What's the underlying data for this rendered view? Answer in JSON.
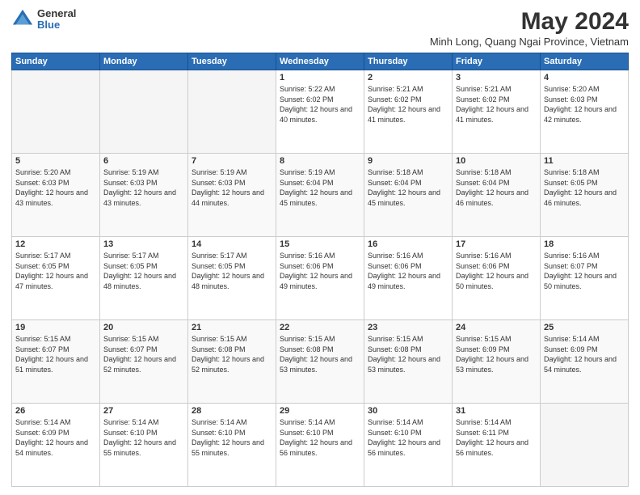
{
  "logo": {
    "general": "General",
    "blue": "Blue"
  },
  "title": "May 2024",
  "subtitle": "Minh Long, Quang Ngai Province, Vietnam",
  "days_header": [
    "Sunday",
    "Monday",
    "Tuesday",
    "Wednesday",
    "Thursday",
    "Friday",
    "Saturday"
  ],
  "weeks": [
    [
      {
        "day": "",
        "info": ""
      },
      {
        "day": "",
        "info": ""
      },
      {
        "day": "",
        "info": ""
      },
      {
        "day": "1",
        "info": "Sunrise: 5:22 AM\nSunset: 6:02 PM\nDaylight: 12 hours\nand 40 minutes."
      },
      {
        "day": "2",
        "info": "Sunrise: 5:21 AM\nSunset: 6:02 PM\nDaylight: 12 hours\nand 41 minutes."
      },
      {
        "day": "3",
        "info": "Sunrise: 5:21 AM\nSunset: 6:02 PM\nDaylight: 12 hours\nand 41 minutes."
      },
      {
        "day": "4",
        "info": "Sunrise: 5:20 AM\nSunset: 6:03 PM\nDaylight: 12 hours\nand 42 minutes."
      }
    ],
    [
      {
        "day": "5",
        "info": "Sunrise: 5:20 AM\nSunset: 6:03 PM\nDaylight: 12 hours\nand 43 minutes."
      },
      {
        "day": "6",
        "info": "Sunrise: 5:19 AM\nSunset: 6:03 PM\nDaylight: 12 hours\nand 43 minutes."
      },
      {
        "day": "7",
        "info": "Sunrise: 5:19 AM\nSunset: 6:03 PM\nDaylight: 12 hours\nand 44 minutes."
      },
      {
        "day": "8",
        "info": "Sunrise: 5:19 AM\nSunset: 6:04 PM\nDaylight: 12 hours\nand 45 minutes."
      },
      {
        "day": "9",
        "info": "Sunrise: 5:18 AM\nSunset: 6:04 PM\nDaylight: 12 hours\nand 45 minutes."
      },
      {
        "day": "10",
        "info": "Sunrise: 5:18 AM\nSunset: 6:04 PM\nDaylight: 12 hours\nand 46 minutes."
      },
      {
        "day": "11",
        "info": "Sunrise: 5:18 AM\nSunset: 6:05 PM\nDaylight: 12 hours\nand 46 minutes."
      }
    ],
    [
      {
        "day": "12",
        "info": "Sunrise: 5:17 AM\nSunset: 6:05 PM\nDaylight: 12 hours\nand 47 minutes."
      },
      {
        "day": "13",
        "info": "Sunrise: 5:17 AM\nSunset: 6:05 PM\nDaylight: 12 hours\nand 48 minutes."
      },
      {
        "day": "14",
        "info": "Sunrise: 5:17 AM\nSunset: 6:05 PM\nDaylight: 12 hours\nand 48 minutes."
      },
      {
        "day": "15",
        "info": "Sunrise: 5:16 AM\nSunset: 6:06 PM\nDaylight: 12 hours\nand 49 minutes."
      },
      {
        "day": "16",
        "info": "Sunrise: 5:16 AM\nSunset: 6:06 PM\nDaylight: 12 hours\nand 49 minutes."
      },
      {
        "day": "17",
        "info": "Sunrise: 5:16 AM\nSunset: 6:06 PM\nDaylight: 12 hours\nand 50 minutes."
      },
      {
        "day": "18",
        "info": "Sunrise: 5:16 AM\nSunset: 6:07 PM\nDaylight: 12 hours\nand 50 minutes."
      }
    ],
    [
      {
        "day": "19",
        "info": "Sunrise: 5:15 AM\nSunset: 6:07 PM\nDaylight: 12 hours\nand 51 minutes."
      },
      {
        "day": "20",
        "info": "Sunrise: 5:15 AM\nSunset: 6:07 PM\nDaylight: 12 hours\nand 52 minutes."
      },
      {
        "day": "21",
        "info": "Sunrise: 5:15 AM\nSunset: 6:08 PM\nDaylight: 12 hours\nand 52 minutes."
      },
      {
        "day": "22",
        "info": "Sunrise: 5:15 AM\nSunset: 6:08 PM\nDaylight: 12 hours\nand 53 minutes."
      },
      {
        "day": "23",
        "info": "Sunrise: 5:15 AM\nSunset: 6:08 PM\nDaylight: 12 hours\nand 53 minutes."
      },
      {
        "day": "24",
        "info": "Sunrise: 5:15 AM\nSunset: 6:09 PM\nDaylight: 12 hours\nand 53 minutes."
      },
      {
        "day": "25",
        "info": "Sunrise: 5:14 AM\nSunset: 6:09 PM\nDaylight: 12 hours\nand 54 minutes."
      }
    ],
    [
      {
        "day": "26",
        "info": "Sunrise: 5:14 AM\nSunset: 6:09 PM\nDaylight: 12 hours\nand 54 minutes."
      },
      {
        "day": "27",
        "info": "Sunrise: 5:14 AM\nSunset: 6:10 PM\nDaylight: 12 hours\nand 55 minutes."
      },
      {
        "day": "28",
        "info": "Sunrise: 5:14 AM\nSunset: 6:10 PM\nDaylight: 12 hours\nand 55 minutes."
      },
      {
        "day": "29",
        "info": "Sunrise: 5:14 AM\nSunset: 6:10 PM\nDaylight: 12 hours\nand 56 minutes."
      },
      {
        "day": "30",
        "info": "Sunrise: 5:14 AM\nSunset: 6:10 PM\nDaylight: 12 hours\nand 56 minutes."
      },
      {
        "day": "31",
        "info": "Sunrise: 5:14 AM\nSunset: 6:11 PM\nDaylight: 12 hours\nand 56 minutes."
      },
      {
        "day": "",
        "info": ""
      }
    ]
  ]
}
